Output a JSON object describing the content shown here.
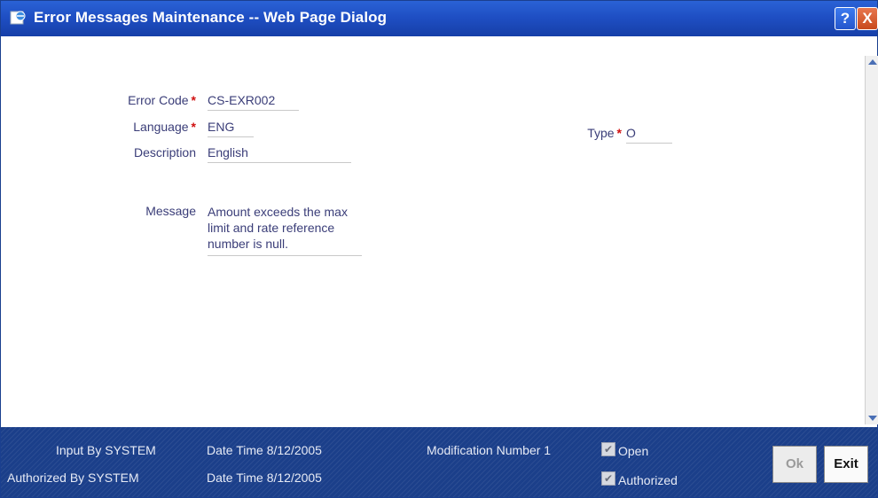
{
  "window": {
    "title": "Error Messages Maintenance -- Web Page Dialog",
    "help_glyph": "?",
    "close_glyph": "X"
  },
  "form": {
    "error_code_label": "Error Code",
    "error_code_value": "CS-EXR002",
    "language_label": "Language",
    "language_value": "ENG",
    "description_label": "Description",
    "description_value": "English",
    "type_label": "Type",
    "type_value": "O",
    "message_label": "Message",
    "message_lines": [
      "Amount exceeds the max",
      "limit and rate reference",
      "number is null."
    ],
    "required_marker": "*"
  },
  "footer": {
    "input_by": "Input By SYSTEM",
    "input_datetime": "Date Time 8/12/2005",
    "authorized_by": "Authorized By SYSTEM",
    "authorized_datetime": "Date Time 8/12/2005",
    "modification_number": "Modification Number 1",
    "open_label": "Open",
    "open_checked": true,
    "authorized_label": "Authorized",
    "authorized_checked": true,
    "ok_label": "Ok",
    "exit_label": "Exit"
  },
  "colors": {
    "titlebar": "#1f4fc4",
    "footer": "#1b3f8a",
    "label_text": "#3a3d78",
    "required": "#d01010"
  }
}
